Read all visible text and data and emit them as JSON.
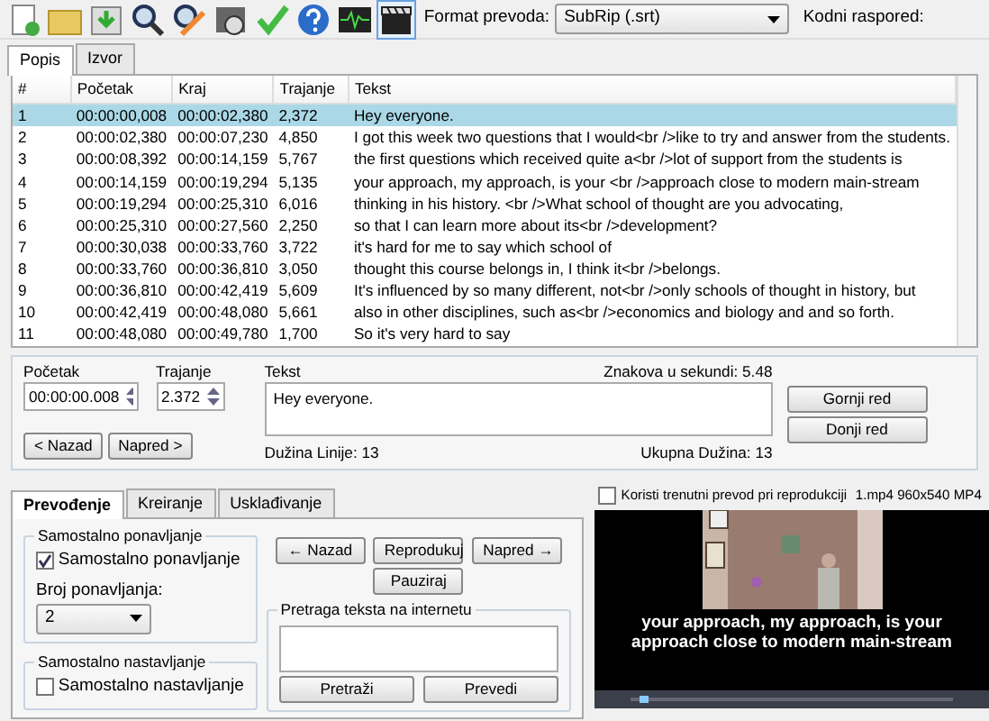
{
  "toolbar": {
    "icons": [
      {
        "kind": "new"
      },
      {
        "kind": "open"
      },
      {
        "kind": "save"
      },
      {
        "kind": "find"
      },
      {
        "kind": "replace"
      },
      {
        "kind": "video"
      },
      {
        "kind": "check"
      },
      {
        "kind": "help"
      },
      {
        "kind": "waveform"
      },
      {
        "kind": "clapper",
        "selected": true
      }
    ],
    "format_label": "Format prevoda:",
    "format_value": "SubRip (.srt)",
    "encoding_label": "Kodni raspored:"
  },
  "tabs": [
    {
      "label": "Popis",
      "selected": true
    },
    {
      "label": "Izvor",
      "selected": false
    }
  ],
  "table": {
    "columns": [
      "#",
      "Početak",
      "Kraj",
      "Trajanje",
      "Tekst"
    ],
    "rows": [
      {
        "cells": [
          "1",
          "00:00:00,008",
          "00:00:02,380",
          "2,372",
          "Hey everyone."
        ],
        "selected": true
      },
      {
        "cells": [
          "2",
          "00:00:02,380",
          "00:00:07,230",
          "4,850",
          "I got this week two questions that I would<br />like to try and answer from the students."
        ],
        "selected": false
      },
      {
        "cells": [
          "3",
          "00:00:08,392",
          "00:00:14,159",
          "5,767",
          "the first questions which received quite a<br />lot of support from the students is"
        ],
        "selected": false
      },
      {
        "cells": [
          "4",
          "00:00:14,159",
          "00:00:19,294",
          "5,135",
          "your approach, my approach, is your <br />approach close to modern main-stream"
        ],
        "selected": false
      },
      {
        "cells": [
          "5",
          "00:00:19,294",
          "00:00:25,310",
          "6,016",
          "thinking in his history. <br />What school of thought are you advocating,"
        ],
        "selected": false
      },
      {
        "cells": [
          "6",
          "00:00:25,310",
          "00:00:27,560",
          "2,250",
          "so that I can learn more about its<br />development?"
        ],
        "selected": false
      },
      {
        "cells": [
          "7",
          "00:00:30,038",
          "00:00:33,760",
          "3,722",
          "it's hard for me to say which school of"
        ],
        "selected": false
      },
      {
        "cells": [
          "8",
          "00:00:33,760",
          "00:00:36,810",
          "3,050",
          "thought this course belongs in, I think it<br />belongs."
        ],
        "selected": false
      },
      {
        "cells": [
          "9",
          "00:00:36,810",
          "00:00:42,419",
          "5,609",
          "It's influenced by so many different, not<br />only schools of thought in history, but"
        ],
        "selected": false
      },
      {
        "cells": [
          "10",
          "00:00:42,419",
          "00:00:48,080",
          "5,661",
          "also in other disciplines, such as<br />economics and biology and and so forth."
        ],
        "selected": false
      },
      {
        "cells": [
          "11",
          "00:00:48,080",
          "00:00:49,780",
          "1,700",
          "So it's very hard to say"
        ],
        "selected": false
      }
    ]
  },
  "editor": {
    "start_label": "Početak",
    "start_value": "00:00:00.008",
    "duration_label": "Trajanje",
    "duration_value": "2.372",
    "text_label": "Tekst",
    "cps": "Znakova u sekundi: 5.48",
    "text_value": "Hey everyone.",
    "line_length": "Dužina Linije:  13",
    "total_length": "Ukupna Dužina:  13",
    "prev_button": "< Nazad",
    "next_button": "Napred >",
    "upper_button": "Gornji red",
    "lower_button": "Donji red"
  },
  "bottom_tabs": [
    {
      "label": "Prevođenje",
      "selected": true
    },
    {
      "label": "Kreiranje",
      "selected": false
    },
    {
      "label": "Usklađivanje",
      "selected": false
    }
  ],
  "repeat_group": {
    "title": "Samostalno ponavljanje",
    "checkbox_label": "Samostalno ponavljanje",
    "checked": true,
    "count_label": "Broj ponavljanja:",
    "count_value": "2"
  },
  "continue_group": {
    "title": "Samostalno nastavljanje",
    "checkbox_label": "Samostalno nastavljanje",
    "checked": false
  },
  "player_buttons": [
    "← Nazad",
    "Reprodukuj",
    "Napred →",
    "Pauziraj"
  ],
  "search_group": {
    "title": "Pretraga teksta na internetu",
    "buttons": [
      "Pretraži",
      "Prevedi"
    ]
  },
  "video": {
    "use_current_label": "Koristi trenutni prevod pri reprodukciji",
    "use_current_checked": false,
    "file_info": "1.mp4 960x540 MP4",
    "subtitle": "your approach, my approach, is your approach close to modern main-stream",
    "level": 0.03
  }
}
